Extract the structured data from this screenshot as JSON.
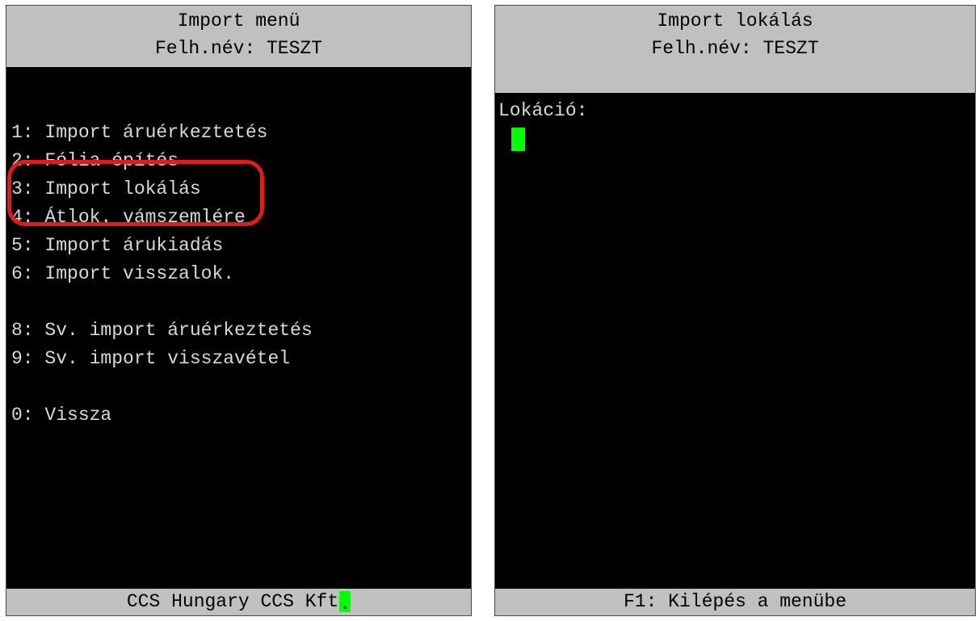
{
  "left_screen": {
    "header_title": "Import menü",
    "header_user": "Felh.név: TESZT",
    "menu_items": [
      "1: Import áruérkeztetés",
      "2: Fólia építés",
      "3: Import lokálás",
      "4: Átlok. vámszemlére",
      "5: Import árukiadás",
      "6: Import visszalok.",
      "8: Sv. import áruérkeztetés",
      "9: Sv. import visszavétel",
      "0: Vissza"
    ],
    "footer_text": "CCS Hungary CCS Kft",
    "footer_cursor_char": "."
  },
  "right_screen": {
    "header_title": "Import lokálás",
    "header_user": "Felh.név: TESZT",
    "field_label": "Lokáció:",
    "field_value": "",
    "footer_text": "F1: Kilépés a menübe"
  },
  "colors": {
    "terminal_background": "#000000",
    "bar_background": "#c0c0c0",
    "terminal_text": "#d8d8d8",
    "cursor": "#00ff00",
    "highlight_ring": "#e11b1b"
  }
}
